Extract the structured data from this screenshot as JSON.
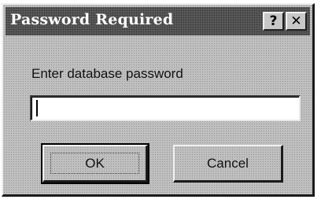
{
  "window": {
    "title": "Password Required",
    "help_label": "?",
    "close_label": "✕"
  },
  "form": {
    "prompt": "Enter database password",
    "password_value": ""
  },
  "buttons": {
    "ok_label": "OK",
    "cancel_label": "Cancel"
  },
  "icons": {
    "help": "question-mark-icon",
    "close": "close-icon"
  }
}
